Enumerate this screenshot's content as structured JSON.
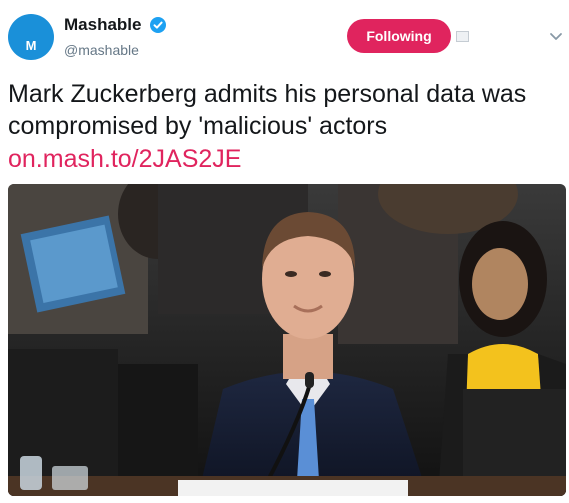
{
  "account": {
    "display_name": "Mashable",
    "handle": "@mashable",
    "avatar_letter": "M",
    "avatar_color": "#1a90d9",
    "verified": true
  },
  "actions": {
    "follow_label": "Following",
    "follow_color": "#e0245e"
  },
  "tweet": {
    "text": "Mark Zuckerberg admits his personal data was compromised by 'malicious' actors",
    "link": "on.mash.to/2JAS2JE",
    "link_color": "#e0245e"
  },
  "icons": {
    "verified": "verified-badge-icon",
    "mute": "mute-icon",
    "menu": "chevron-down-icon"
  }
}
